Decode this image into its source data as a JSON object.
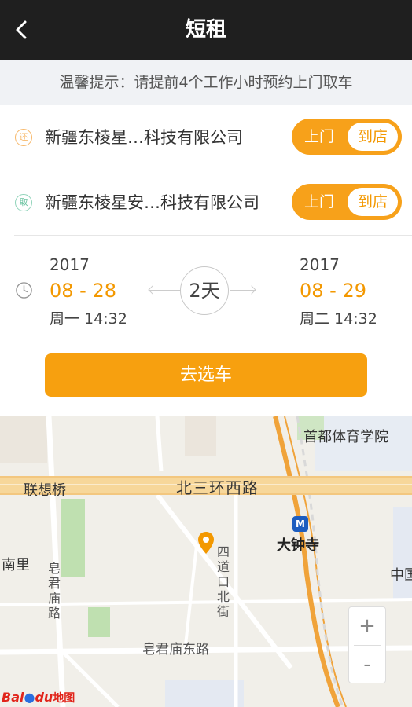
{
  "nav": {
    "title": "短租",
    "back_icon": "chevron-left-icon"
  },
  "tip": "温馨提示：请提前4个工作小时预约上门取车",
  "locations": [
    {
      "badge": "还",
      "name": "新疆东棱星…科技有限公司",
      "toggle_door": "上门",
      "toggle_store": "到店",
      "selected": "到店"
    },
    {
      "badge": "取",
      "name": "新疆东棱星安…科技有限公司",
      "toggle_door": "上门",
      "toggle_store": "到店",
      "selected": "到店"
    }
  ],
  "rental": {
    "start": {
      "year": "2017",
      "date": "08 - 28",
      "time": "周一 14:32"
    },
    "end": {
      "year": "2017",
      "date": "08 - 29",
      "time": "周二 14:32"
    },
    "duration": "2天"
  },
  "select_button": "去选车",
  "map": {
    "labels": {
      "ring_road": "北三环西路",
      "bridge": "联想桥",
      "university": "首都体育学院",
      "metro_station": "大钟寺",
      "street_v": "四道口北街",
      "street_h": "皂君庙东路",
      "street_v2": "皂君庙路",
      "left_edge": "南里",
      "right_edge": "中国"
    },
    "metro_icon": "metro-icon",
    "zoom_in": "+",
    "zoom_out": "-",
    "logo_bai": "Bai",
    "logo_du": "du",
    "logo_map": "地图"
  },
  "colors": {
    "accent": "#f39800",
    "navbar": "#1f1f1f",
    "tip_bg": "#f0f2f5"
  }
}
